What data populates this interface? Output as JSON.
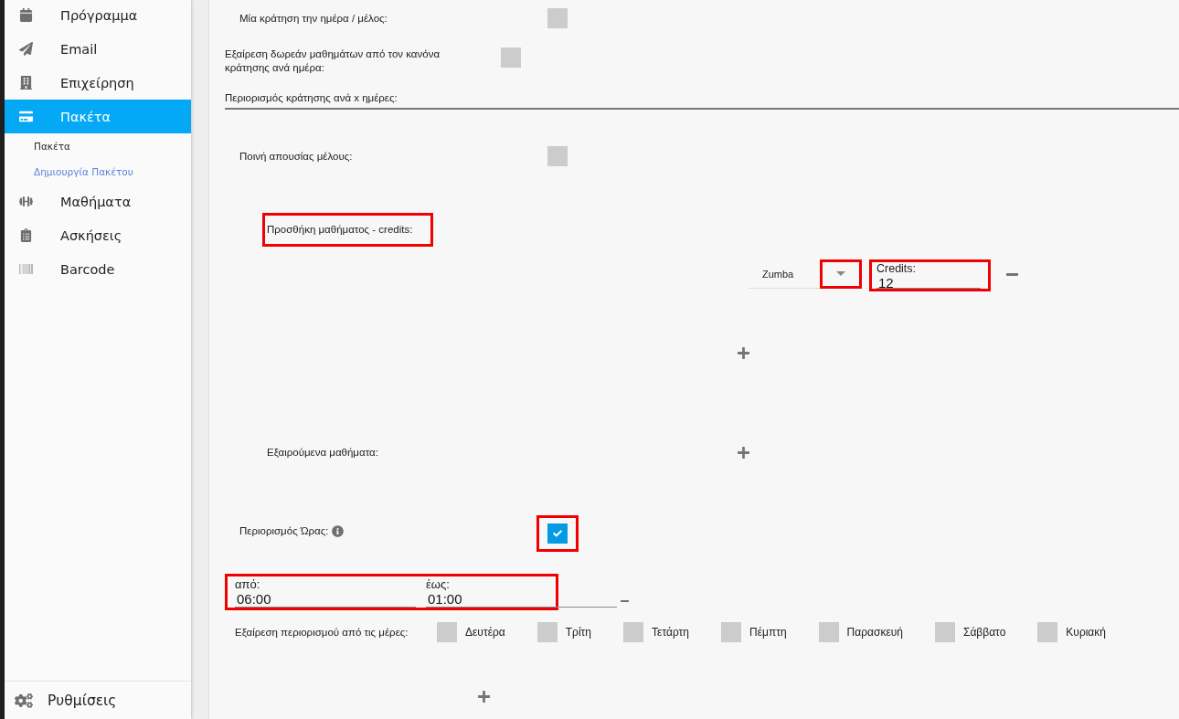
{
  "sidebar": {
    "items": [
      {
        "label": "Πρόγραμμα",
        "selected": false
      },
      {
        "label": "Email",
        "selected": false
      },
      {
        "label": "Επιχείρηση",
        "selected": false
      },
      {
        "label": "Πακέτα",
        "selected": true,
        "children": [
          {
            "label": "Πακέτα",
            "selected": false
          },
          {
            "label": "Δημιουργία Πακέτου",
            "selected": true
          }
        ]
      },
      {
        "label": "Μαθήματα",
        "selected": false
      },
      {
        "label": "Ασκήσεις",
        "selected": false
      },
      {
        "label": "Barcode",
        "selected": false
      }
    ],
    "settings": {
      "label": "Ρυθμίσεις"
    }
  },
  "form": {
    "one_booking_per_day": {
      "label": "Μία κράτηση την ημέρα / μέλος:",
      "checked": false
    },
    "exclude_free_lessons": {
      "label": "Εξαίρεση δωρεάν μαθημάτων από τον κανόνα κράτησης ανά ημέρα:",
      "checked": false
    },
    "booking_limit_days": {
      "placeholder": "Περιορισμός κράτησης ανά x ημέρες:"
    },
    "absence_penalty": {
      "label": "Ποινή απουσίας μέλους:",
      "checked": false
    },
    "lesson_credits": {
      "label": "Προσθήκη μαθήματος - credits:",
      "highlighted": true,
      "rows": [
        {
          "lesson": "Zumba",
          "dropdown_highlighted": true,
          "credits_label": "Credits:",
          "credits": "12",
          "credits_highlighted": true
        }
      ]
    },
    "excluded_lessons": {
      "label": "Εξαιρούμενα μαθήματα:"
    },
    "time_restriction": {
      "label": "Περιορισμός Ώρας:",
      "checked": true,
      "checkbox_highlighted": true,
      "range_highlighted": true,
      "from_label": "από:",
      "from": "06:00",
      "to_label": "έως:",
      "to": "01:00",
      "exclude_days_label": "Εξαίρεση περιορισμού από τις μέρες:",
      "days": [
        {
          "label": "Δευτέρα",
          "checked": false
        },
        {
          "label": "Τρίτη",
          "checked": false
        },
        {
          "label": "Τετάρτη",
          "checked": false
        },
        {
          "label": "Πέμπτη",
          "checked": false
        },
        {
          "label": "Παρασκευή",
          "checked": false
        },
        {
          "label": "Σάββατο",
          "checked": false
        },
        {
          "label": "Κυριακή",
          "checked": false
        }
      ]
    }
  }
}
